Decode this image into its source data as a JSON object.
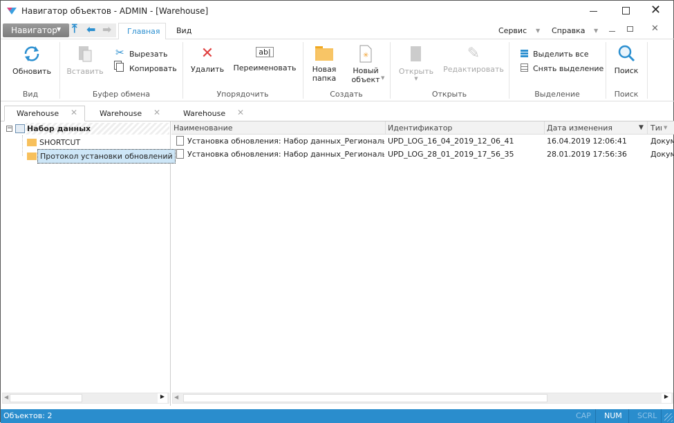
{
  "window": {
    "title": "Навигатор объектов - ADMIN - [Warehouse]"
  },
  "menu": {
    "navigator": "Навигатор",
    "tabs": [
      {
        "label": "Главная",
        "active": true
      },
      {
        "label": "Вид"
      }
    ],
    "service": "Сервис",
    "help": "Справка"
  },
  "ribbon": {
    "groups": [
      {
        "label": "Вид"
      },
      {
        "label": "Буфер обмена"
      },
      {
        "label": "Упорядочить"
      },
      {
        "label": "Создать"
      },
      {
        "label": "Открыть"
      },
      {
        "label": "Выделение"
      },
      {
        "label": "Поиск"
      }
    ],
    "refresh": "Обновить",
    "paste": "Вставить",
    "cut": "Вырезать",
    "copy": "Копировать",
    "delete": "Удалить",
    "rename": "Переименовать",
    "rename_icon_text": "ab|",
    "new_folder": [
      "Новая",
      "папка"
    ],
    "new_object": [
      "Новый",
      "объект"
    ],
    "open": "Открыть",
    "edit": "Редактировать",
    "select_all": "Выделить все",
    "deselect": "Снять выделение",
    "search": "Поиск"
  },
  "doc_tabs": [
    {
      "label": "Warehouse",
      "active": true
    },
    {
      "label": "Warehouse"
    },
    {
      "label": "Warehouse"
    }
  ],
  "tree": {
    "root": "Набор данных",
    "items": [
      {
        "label": "SHORTCUT"
      },
      {
        "label": "Протокол установки обновлений",
        "selected": true
      }
    ]
  },
  "list": {
    "columns": [
      "Наименование",
      "Идентификатор",
      "Дата изменения",
      "Тип"
    ],
    "rows": [
      [
        "Установка обновления: Набор данных_Региональны...",
        "UPD_LOG_16_04_2019_12_06_41",
        "16.04.2019 12:06:41",
        "Докум"
      ],
      [
        "Установка обновления: Набор данных_Региональны...",
        "UPD_LOG_28_01_2019_17_56_35",
        "28.01.2019 17:56:36",
        "Докум"
      ]
    ]
  },
  "status": {
    "objects": "Объектов: 2",
    "cap": "CAP",
    "num": "NUM",
    "scrl": "SCRL"
  },
  "colors": {
    "accent": "#2b8fd0",
    "status_bar": "#2a8dcd",
    "delete": "#e04040",
    "folder": "#f7c05c"
  }
}
